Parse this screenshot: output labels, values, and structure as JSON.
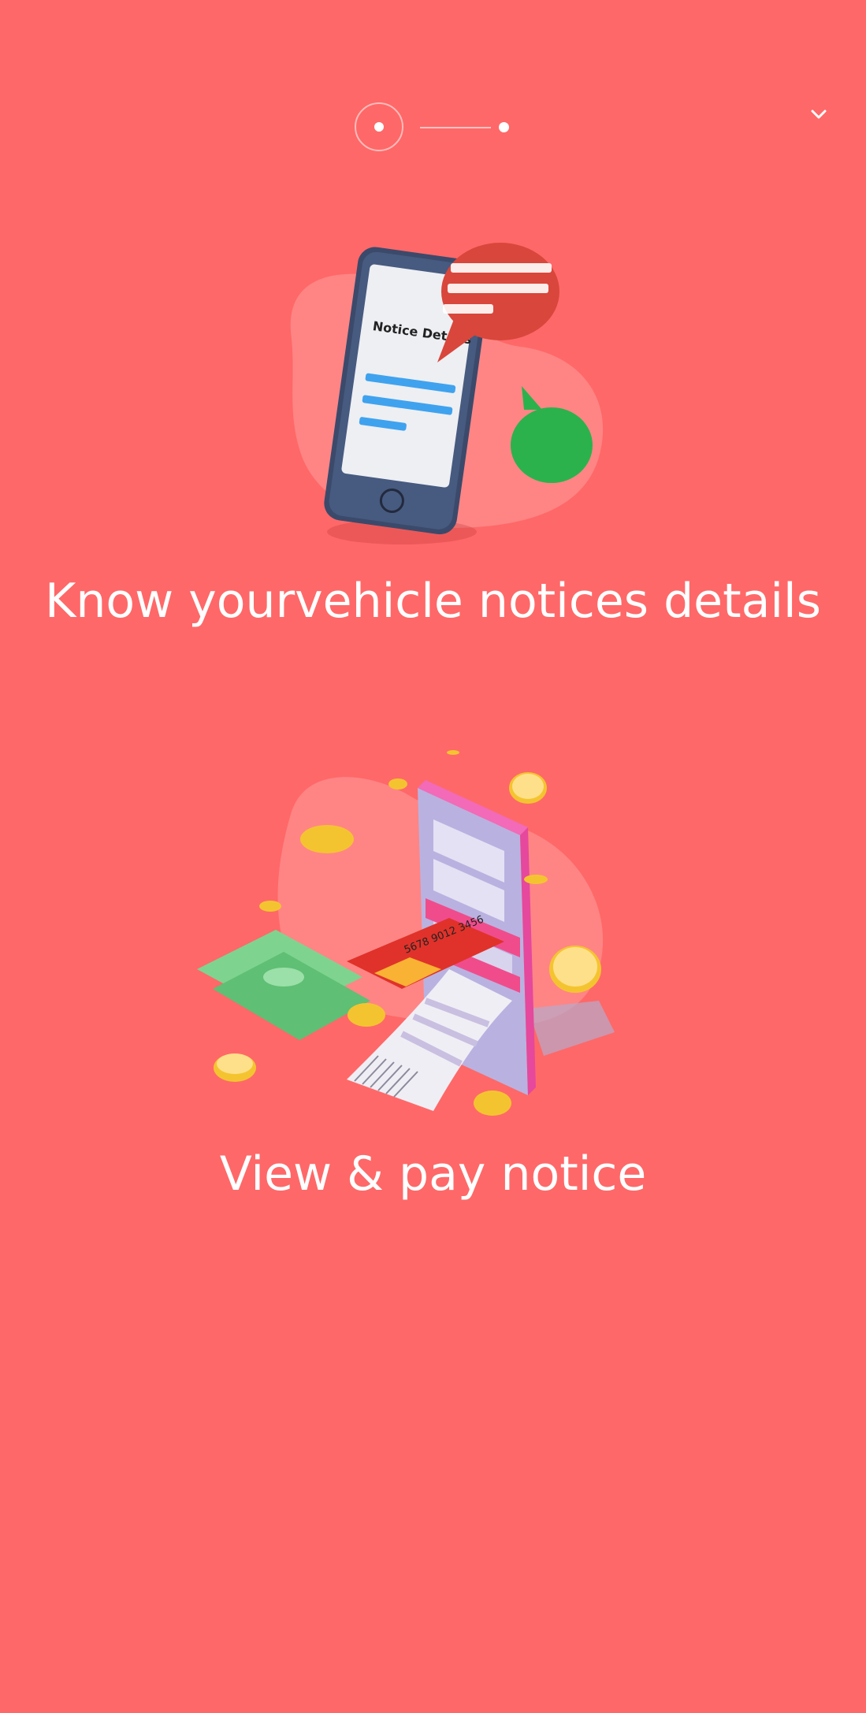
{
  "onboarding": {
    "steps": [
      {
        "state": "active"
      },
      {
        "state": "inactive"
      }
    ],
    "dismiss_icon": "chevron-down-icon"
  },
  "features": [
    {
      "title": "Know yourvehicle notices details",
      "illustration": "phone-notice-details",
      "illustration_text": "Notice Details"
    },
    {
      "title": "View & pay notice",
      "illustration": "phone-card-payment",
      "illustration_text": "5678 9012 3456"
    }
  ],
  "colors": {
    "background": "#FF6868",
    "blob": "#FF8585",
    "text": "#FFFFFF"
  }
}
